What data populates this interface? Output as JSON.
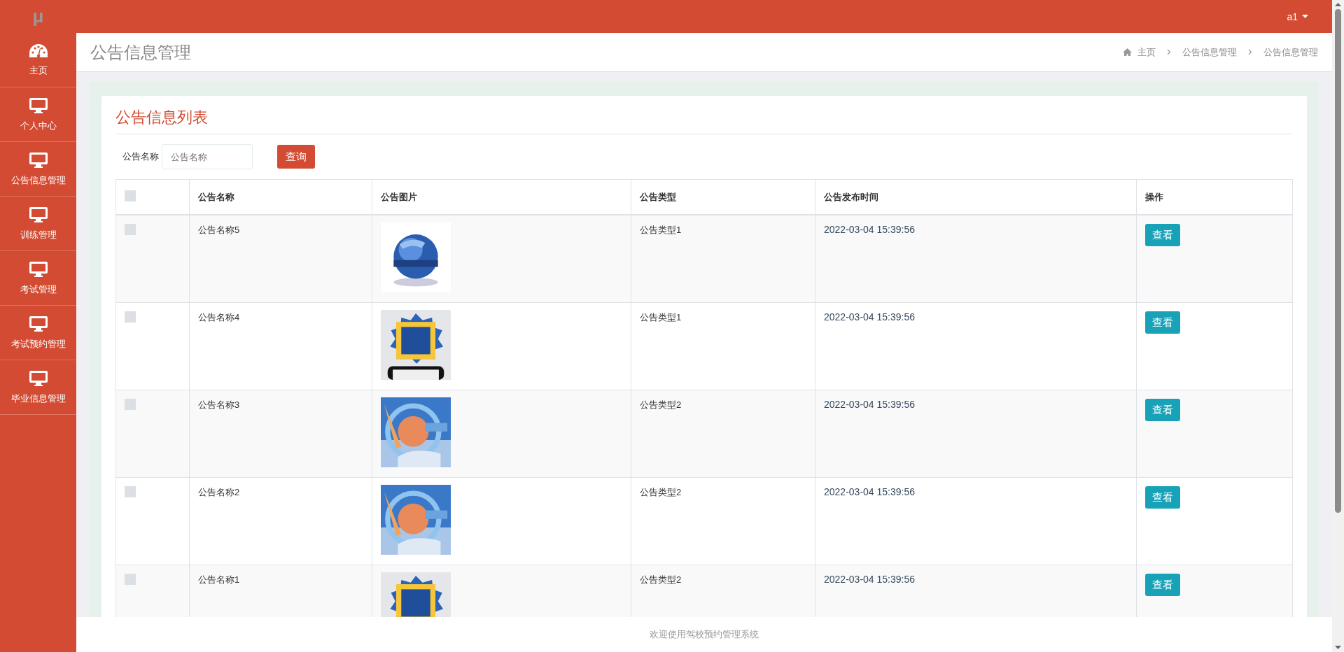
{
  "logo": "μ",
  "user": {
    "name": "a1"
  },
  "sidebar": {
    "items": [
      {
        "label": "主页",
        "kind": "dashboard"
      },
      {
        "label": "个人中心",
        "kind": "monitor"
      },
      {
        "label": "公告信息管理",
        "kind": "monitor"
      },
      {
        "label": "训练管理",
        "kind": "monitor"
      },
      {
        "label": "考试管理",
        "kind": "monitor"
      },
      {
        "label": "考试预约管理",
        "kind": "monitor"
      },
      {
        "label": "毕业信息管理",
        "kind": "monitor"
      }
    ]
  },
  "page_title": "公告信息管理",
  "breadcrumb": [
    "主页",
    "公告信息管理",
    "公告信息管理"
  ],
  "card_title": "公告信息列表",
  "search": {
    "label": "公告名称",
    "placeholder": "公告名称",
    "button": "查询"
  },
  "table": {
    "header_checked": false,
    "columns": [
      "公告名称",
      "公告图片",
      "公告类型",
      "公告发布时间",
      "操作"
    ],
    "rows": [
      {
        "checked": false,
        "name": "公告名称5",
        "type": "公告类型1",
        "time": "2022-03-04 15:39:56",
        "action": "查看"
      },
      {
        "checked": false,
        "name": "公告名称4",
        "type": "公告类型1",
        "time": "2022-03-04 15:39:56",
        "action": "查看"
      },
      {
        "checked": false,
        "name": "公告名称3",
        "type": "公告类型2",
        "time": "2022-03-04 15:39:56",
        "action": "查看"
      },
      {
        "checked": false,
        "name": "公告名称2",
        "type": "公告类型2",
        "time": "2022-03-04 15:39:56",
        "action": "查看"
      },
      {
        "checked": false,
        "name": "公告名称1",
        "type": "公告类型2",
        "time": "2022-03-04 15:39:56",
        "action": "查看"
      }
    ]
  },
  "footer": "欢迎使用驾校预约管理系统"
}
